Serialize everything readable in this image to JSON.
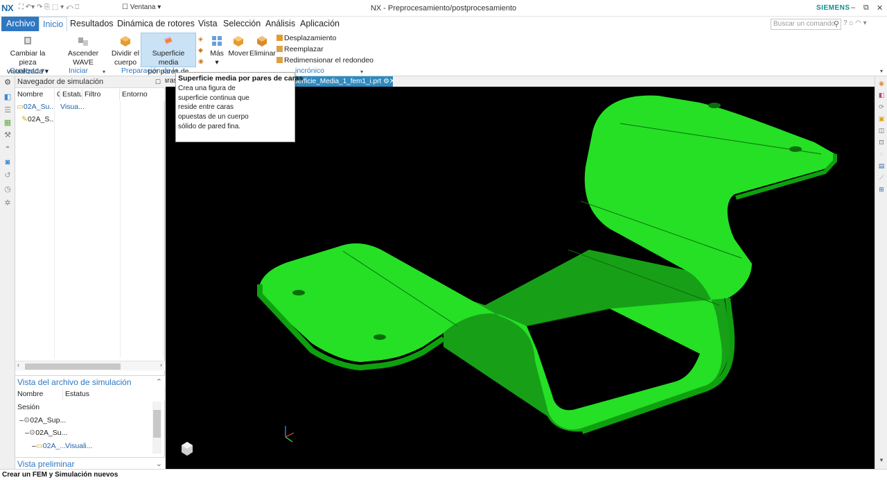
{
  "titlebar": {
    "logo": "NX",
    "window_menu": "Ventana",
    "title": "NX - Preprocesamiento/postprocesamiento",
    "brand": "SIEMENS"
  },
  "menubar": {
    "tabs": [
      "Archivo",
      "Inicio",
      "Resultados",
      "Dinámica de rotores",
      "Vista",
      "Selección",
      "Análisis",
      "Aplicación"
    ],
    "search_placeholder": "Buscar un comando"
  },
  "ribbon": {
    "cambiar_l1": "Cambiar la pieza",
    "cambiar_l2": "visualizada",
    "ascender": "Ascender WAVE",
    "dividir_l1": "Dividir el",
    "dividir_l2": "cuerpo",
    "superficie_l1": "Superficie media",
    "superficie_l2": "por pares de caras",
    "mas": "Más",
    "mover": "Mover",
    "eliminar": "Eliminar",
    "desplazamiento": "Desplazamiento",
    "reemplazar": "Reemplazar",
    "redimensionar": "Redimensionar el redondeo",
    "groups": {
      "contexto": "Contexto",
      "iniciar": "Iniciar",
      "preparacion": "Preparación de la",
      "modelado": "incrónico"
    }
  },
  "tooltip": {
    "title": "Superficie media por pares de caras",
    "body": "Crea una figura de superficie continua que reside entre caras opuestas de un cuerpo sólido de pared fina."
  },
  "navigator": {
    "title": "Navegador de simulación",
    "columns": [
      "Nombre",
      "C",
      "Estatu",
      "Filtro",
      "Entorno"
    ],
    "rows": [
      {
        "name": "02A_Su...",
        "status": "Visua..."
      },
      {
        "name": "02A_S...",
        "status": ""
      }
    ]
  },
  "file_view": {
    "title": "Vista del archivo de simulación",
    "columns": [
      "Nombre",
      "Estatus"
    ],
    "rows": [
      {
        "name": "Sesión",
        "status": ""
      },
      {
        "name": "02A_Sup...",
        "status": ""
      },
      {
        "name": "02A_Su...",
        "status": ""
      },
      {
        "name": "02A_...",
        "status": "Visuali..."
      }
    ]
  },
  "preview": {
    "title": "Vista preliminar"
  },
  "viewport": {
    "tab_label": "perficie_Media_1_fem1_i.prt",
    "part_color": "#22e022",
    "background": "#000000"
  },
  "status_bar": {
    "message": "Crear un FEM y Simulación nuevos"
  },
  "colors": {
    "accent": "#2f77c2",
    "highlight": "#c9e2f6"
  }
}
